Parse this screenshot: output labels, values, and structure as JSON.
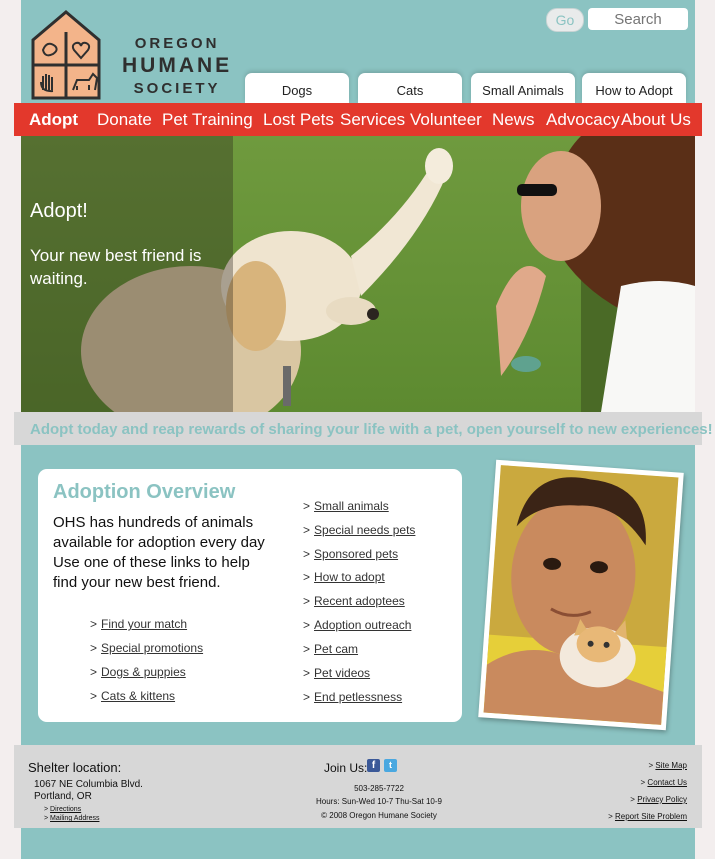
{
  "brand": {
    "line1": "OREGON",
    "line2": "HUMANE",
    "line3": "SOCIETY"
  },
  "search": {
    "go_label": "Go",
    "placeholder": "Search"
  },
  "top_tabs": [
    "Dogs",
    "Cats",
    "Small Animals",
    "How to Adopt"
  ],
  "nav": [
    "Adopt",
    "Donate",
    "Pet Training",
    "Lost Pets",
    "Services",
    "Volunteer",
    "News",
    "Advocacy",
    "About Us"
  ],
  "hero": {
    "title": "Adopt!",
    "subtitle": "Your new best friend is waiting."
  },
  "tagline": "Adopt today and reap rewards of sharing your life with a pet, open yourself to new experiences!",
  "overview": {
    "title": "Adoption Overview",
    "text": "OHS has hundreds of animals available  for adoption every day Use one of these links to help find your new best friend.",
    "left_links": [
      "Find your match",
      "Special promotions",
      "Dogs & puppies",
      "Cats & kittens"
    ],
    "right_links": [
      "Small animals",
      "Special needs pets",
      "Sponsored pets",
      "How to adopt",
      "Recent adoptees",
      "Adoption outreach",
      "Pet cam",
      "Pet videos",
      "End petlessness"
    ]
  },
  "footer": {
    "shelter_title": "Shelter location:",
    "address1": "1067 NE Columbia Blvd.",
    "address2": "Portland, OR",
    "directions": "Directions",
    "mailing": "Mailing Address",
    "join": "Join Us:",
    "phone": "503-285-7722",
    "hours": "Hours: Sun-Wed 10-7  Thu-Sat 10-9",
    "copyright": "© 2008 Oregon Humane Society",
    "right_links": [
      "Site Map",
      "Contact Us",
      "Privacy Policy",
      "Report Site Problem"
    ]
  },
  "colors": {
    "teal": "#8bc3c2",
    "red": "#e3382c",
    "logo_orange": "#f3b48a"
  }
}
